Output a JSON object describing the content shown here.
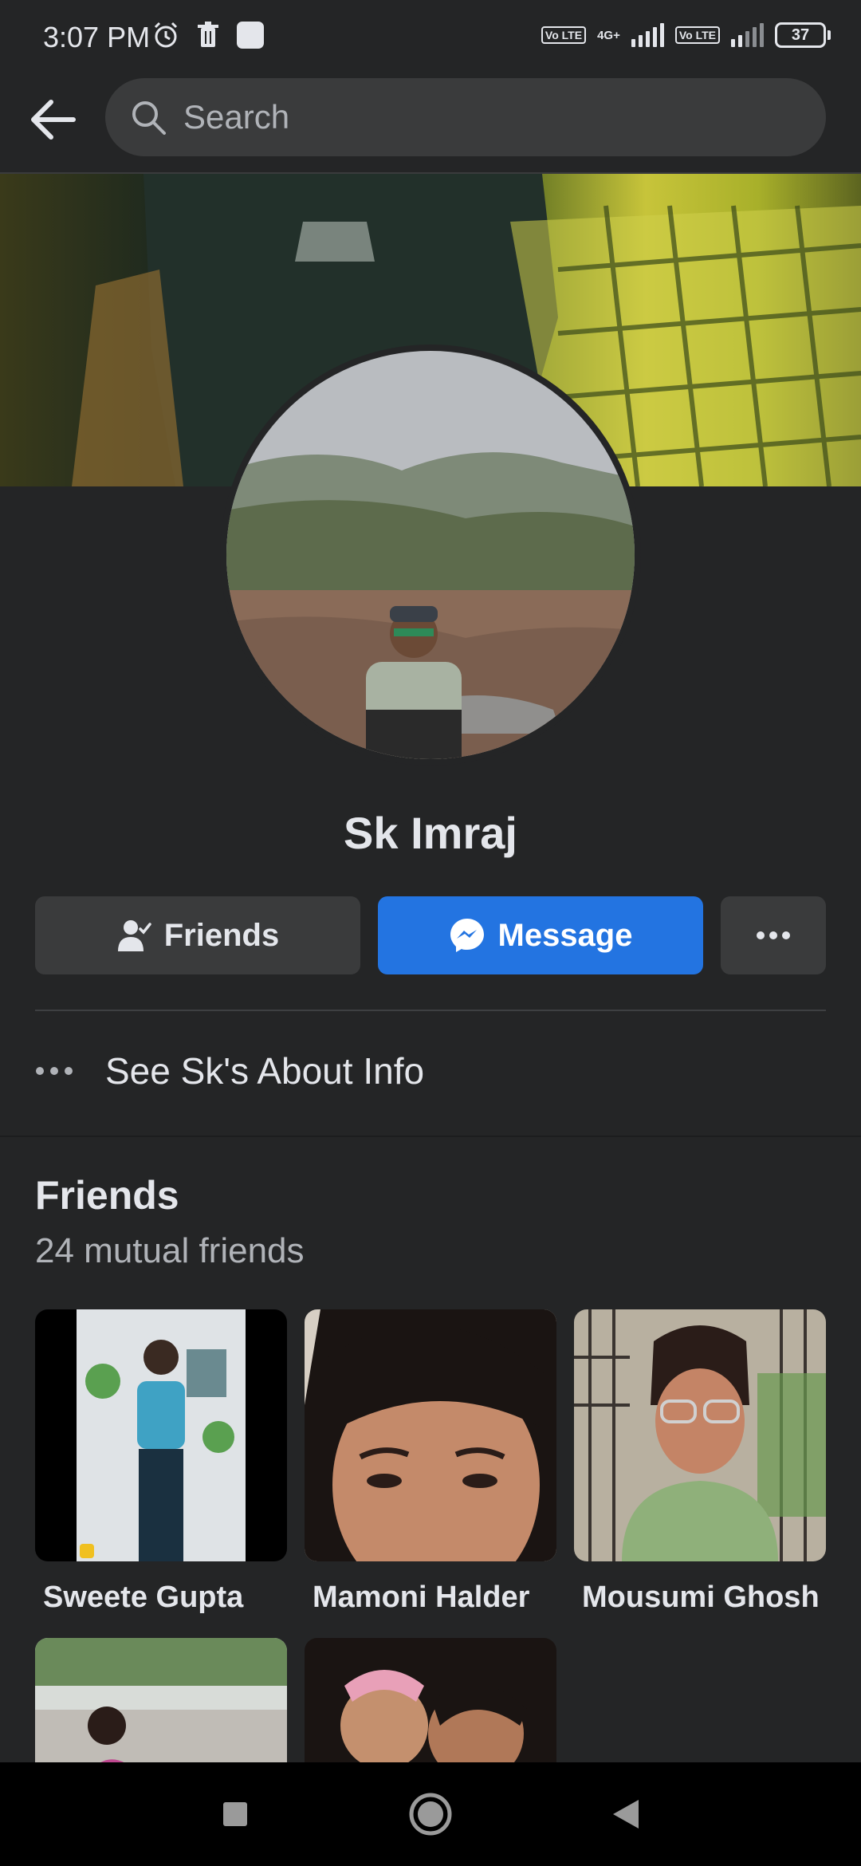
{
  "status_bar": {
    "time": "3:07 PM",
    "network_type": "4G+",
    "volte_label": "Vo LTE",
    "battery": "37"
  },
  "search": {
    "placeholder": "Search"
  },
  "profile": {
    "name": "Sk Imraj",
    "friends_button": "Friends",
    "message_button": "Message",
    "about_link": "See Sk's About Info"
  },
  "friends_section": {
    "title": "Friends",
    "mutual": "24 mutual friends",
    "friends": [
      {
        "name": "Sweete Gupta"
      },
      {
        "name": "Mamoni Halder"
      },
      {
        "name": "Mousumi Ghosh"
      },
      {
        "name": ""
      },
      {
        "name": ""
      }
    ]
  },
  "colors": {
    "background": "#242526",
    "surface": "#3a3b3c",
    "accent": "#2374e1",
    "text_primary": "#e4e6eb",
    "text_secondary": "#b0b3b8"
  },
  "icons": {
    "back": "arrow-left-icon",
    "search": "search-icon",
    "friends": "person-check-icon",
    "message": "messenger-icon",
    "more": "more-horizontal-icon",
    "about": "dots-icon",
    "nav_recent": "square-icon",
    "nav_home": "circle-icon",
    "nav_back": "triangle-icon"
  }
}
